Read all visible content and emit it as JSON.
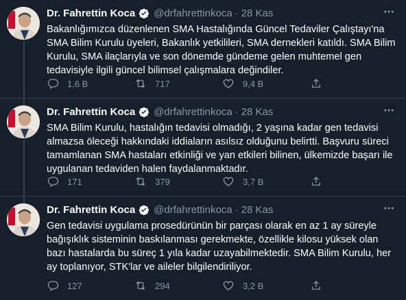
{
  "tweets": [
    {
      "name": "Dr. Fahrettin Koca",
      "handle": "@drfahrettinkoca",
      "dot": "·",
      "time": "28 Kas",
      "text": "Bakanlığımızca düzenlenen SMA Hastalığında Güncel Tedaviler Çalıştayı'na SMA Bilim Kurulu üyeleri, Bakanlık yetkilileri, SMA dernekleri katıldı. SMA Bilim Kurulu, SMA ilaçlarıyla ve son dönemde gündeme gelen muhtemel gen tedavisiyle ilgili güncel bilimsel çalışmalara değindiler.",
      "replies": "1,6 B",
      "retweets": "717",
      "likes": "9,4 B"
    },
    {
      "name": "Dr. Fahrettin Koca",
      "handle": "@drfahrettinkoca",
      "dot": "·",
      "time": "28 Kas",
      "text": "SMA Bilim Kurulu, hastalığın tedavisi olmadığı, 2 yaşına kadar gen tedavisi almazsa öleceği hakkındaki iddiaların asılsız olduğunu belirtti. Başvuru süreci tamamlanan SMA hastaları etkinliği ve yan etkileri bilinen, ülkemizde başarı ile uygulanan tedaviden halen faydalanmaktadır.",
      "replies": "171",
      "retweets": "379",
      "likes": "3,7 B"
    },
    {
      "name": "Dr. Fahrettin Koca",
      "handle": "@drfahrettinkoca",
      "dot": "·",
      "time": "28 Kas",
      "text": "Gen tedavisi uygulama prosedürünün bir parçası olarak en az 1 ay süreyle bağışıklık sisteminin baskılanması gerekmekte, özellikle kilosu yüksek olan bazı hastalarda bu süreç 1 yıla kadar uzayabilmektedir. SMA Bilim Kurulu, her ay toplanıyor, STK'lar ve aileler bilgilendiriliyor.",
      "replies": "127",
      "retweets": "294",
      "likes": "3,2 B"
    }
  ],
  "icons": {
    "verified": "verified-badge-icon",
    "more": "more-options-icon",
    "reply": "reply-icon",
    "retweet": "retweet-icon",
    "like": "like-icon",
    "share": "share-icon"
  },
  "colors": {
    "background": "#15202b",
    "border": "#38444d",
    "muted": "#8899a6",
    "verified": "#ffffff"
  }
}
